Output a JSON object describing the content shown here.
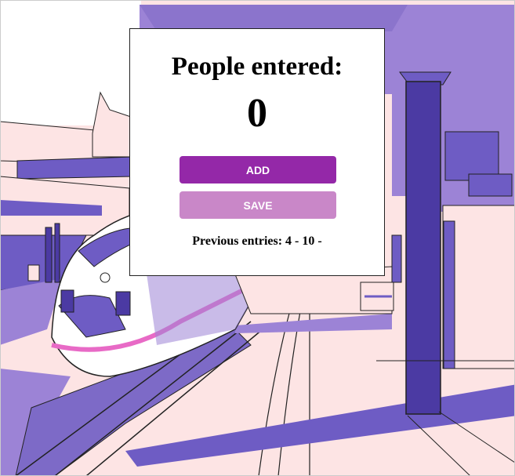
{
  "counter": {
    "title": "People entered:",
    "count": "0",
    "add_label": "ADD",
    "save_label": "SAVE",
    "previous_entries": "Previous entries: 4 - 10 -"
  },
  "colors": {
    "add_button": "#9428a8",
    "save_button": "#c987c8",
    "platform": "#fde4e4",
    "purple": "#6e5cc4",
    "dark_purple": "#4b3aa3",
    "light_purple": "#9c83d6",
    "accent_pink": "#e86ac6"
  },
  "icons": {
    "background": "train-station-illustration"
  }
}
